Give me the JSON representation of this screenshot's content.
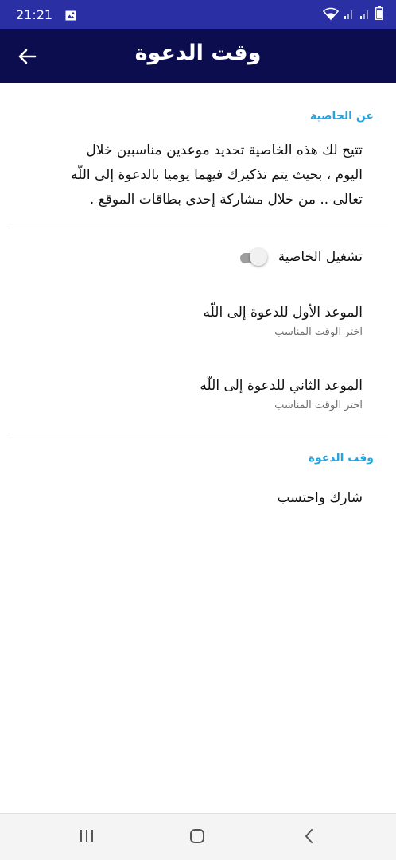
{
  "status_bar": {
    "time": "21:21",
    "icons": [
      "gallery-icon",
      "wifi-icon",
      "signal-icon",
      "signal-icon",
      "battery-icon"
    ]
  },
  "app_bar": {
    "title": "وقت الدعوة",
    "back_icon": "arrow-left-icon"
  },
  "about": {
    "header": "عن الخاصية",
    "lines": [
      "تتيح لك هذه الخاصية تحديد موعدين مناسبين خلال",
      "اليوم ، بحيث يتم تذكيرك فيهما يوميا بالدعوة إلى اللّه",
      "تعالى .. من خلال مشاركة إحدى بطاقات الموقع ."
    ]
  },
  "settings": {
    "toggle_label": "تشغيل الخاصية",
    "toggle_on": false,
    "first_time_title": "الموعد الأول للدعوة إلى اللّه",
    "first_time_sub": "اختر الوقت المناسب",
    "second_time_title": "الموعد الثاني للدعوة إلى اللّه",
    "second_time_sub": "اختر الوقت المناسب"
  },
  "time_section": {
    "header": "وقت الدعوة",
    "share_label": "شارك واحتسب"
  },
  "nav": {
    "icons": [
      "recent-apps-icon",
      "home-icon",
      "back-icon"
    ]
  },
  "colors": {
    "status_bar": "#2a30a4",
    "app_bar": "#0b0d4f",
    "accent": "#29a3dc"
  }
}
